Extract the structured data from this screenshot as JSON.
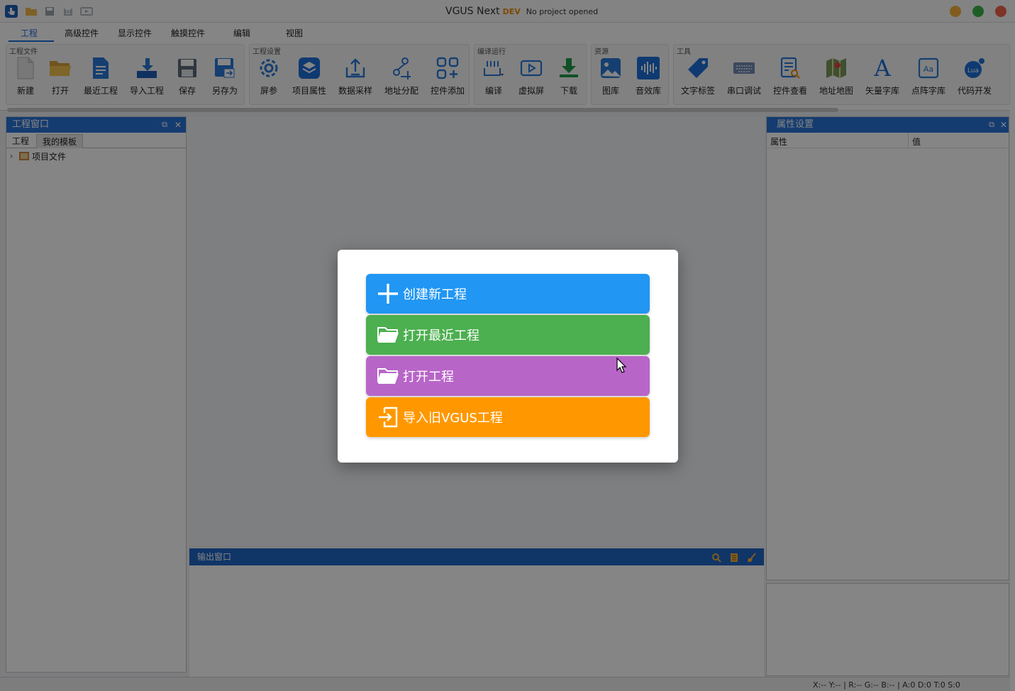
{
  "titlebar": {
    "app_name": "VGUS Next",
    "badge": "DEV",
    "subtitle": "No project opened",
    "quick_icons": [
      "hand-icon",
      "open-folder-icon",
      "save-icon",
      "build-icon",
      "preview-icon"
    ],
    "window_buttons": [
      {
        "name": "minimize-button",
        "color": "#f5b33a"
      },
      {
        "name": "maximize-button",
        "color": "#3bb54a"
      },
      {
        "name": "close-button",
        "color": "#f06449"
      }
    ]
  },
  "tabs": [
    "工程",
    "高级控件",
    "显示控件",
    "触摸控件",
    "编辑",
    "视图"
  ],
  "active_tab": "工程",
  "ribbon": {
    "groups": [
      {
        "label": "工程文件",
        "buttons": [
          "新建",
          "打开",
          "最近工程",
          "导入工程",
          "保存",
          "另存为"
        ]
      },
      {
        "label": "工程设置",
        "buttons": [
          "屏参",
          "项目属性",
          "数据采样",
          "地址分配",
          "控件添加"
        ]
      },
      {
        "label": "编译运行",
        "buttons": [
          "编译",
          "虚拟屏",
          "下载"
        ]
      },
      {
        "label": "资源",
        "buttons": [
          "图库",
          "音效库"
        ]
      },
      {
        "label": "工具",
        "buttons": [
          "文字标签",
          "串口调试",
          "控件查看",
          "地址地图",
          "矢量字库",
          "点阵字库",
          "代码开发"
        ]
      }
    ]
  },
  "left_panel": {
    "title": "工程窗口",
    "subtabs": [
      "工程",
      "我的模板"
    ],
    "tree": [
      {
        "label": "项目文件"
      }
    ]
  },
  "output_panel": {
    "title": "输出窗口"
  },
  "right_panel": {
    "title": "属性设置",
    "columns": [
      "属性",
      "值"
    ]
  },
  "statusbar": {
    "text": "X:-- Y:-- | R:-- G:-- B:-- | A:0 D:0 T:0 S:0"
  },
  "dialog": {
    "actions": [
      {
        "label": "创建新工程",
        "icon": "plus-icon",
        "color": "#2196f3"
      },
      {
        "label": "打开最近工程",
        "icon": "folder-open-icon",
        "color": "#4caf50"
      },
      {
        "label": "打开工程",
        "icon": "folder-open-icon",
        "color": "#b865c8"
      },
      {
        "label": "导入旧VGUS工程",
        "icon": "import-icon",
        "color": "#ff9800"
      }
    ]
  }
}
